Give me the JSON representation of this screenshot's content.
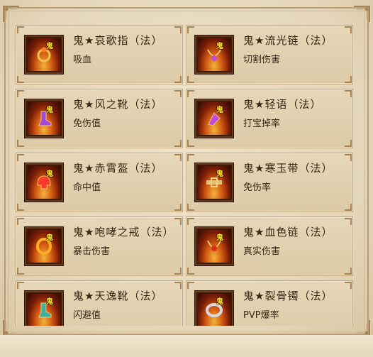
{
  "colors": {
    "panel_bg": "#e9dcc3",
    "card_bg": "#dccaa6",
    "border": "#b79c74",
    "text": "#3a2412",
    "tag": "#ffe23a"
  },
  "items": [
    {
      "tag": "鬼",
      "name": "鬼★哀歌指（法）",
      "effect": "吸血",
      "icon": "ring-icon",
      "gem": "#ff7a2a"
    },
    {
      "tag": "鬼",
      "name": "鬼★流光链（法）",
      "effect": "切割伤害",
      "icon": "necklace-icon",
      "gem": "#c64ad8"
    },
    {
      "tag": "鬼",
      "name": "鬼★风之靴（法）",
      "effect": "免伤值",
      "icon": "boots-icon",
      "gem": "#a24ae0"
    },
    {
      "tag": "鬼",
      "name": "鬼★轻语（法）",
      "effect": "打宝掉率",
      "icon": "charm-icon",
      "gem": "#c04ae0"
    },
    {
      "tag": "鬼",
      "name": "鬼★赤霄盔（法）",
      "effect": "命中值",
      "icon": "helmet-icon",
      "gem": "#ff3a2a"
    },
    {
      "tag": "鬼",
      "name": "鬼★寒玉带（法）",
      "effect": "免伤率",
      "icon": "belt-icon",
      "gem": "#e0c07a"
    },
    {
      "tag": "鬼",
      "name": "鬼★咆哮之戒（法）",
      "effect": "暴击伤害",
      "icon": "ring-icon",
      "gem": "#ffb020"
    },
    {
      "tag": "鬼",
      "name": "鬼★血色链（法）",
      "effect": "真实伤害",
      "icon": "necklace-icon",
      "gem": "#d8301a"
    },
    {
      "tag": "鬼",
      "name": "鬼★天逸靴（法）",
      "effect": "闪避值",
      "icon": "boots-icon",
      "gem": "#3ab0a8"
    },
    {
      "tag": "鬼",
      "name": "鬼★裂骨镯（法）",
      "effect": "PVP爆率",
      "icon": "bracelet-icon",
      "gem": "#d8d8e0"
    }
  ]
}
